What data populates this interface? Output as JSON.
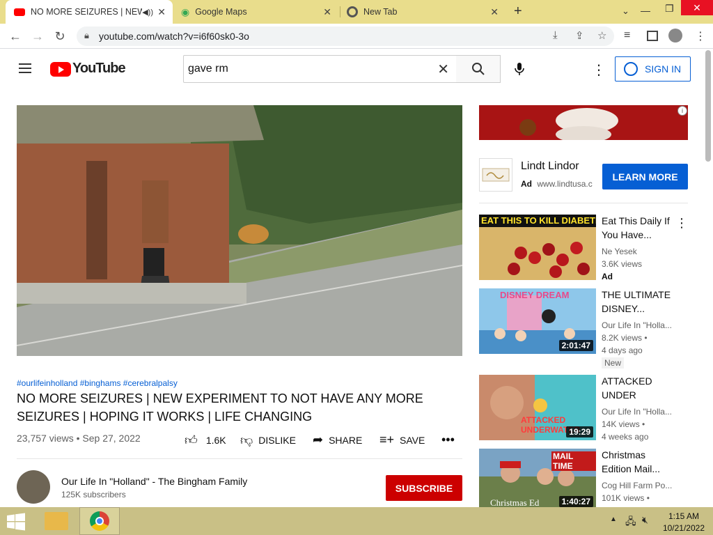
{
  "browser": {
    "tabs": [
      {
        "title": "NO MORE SEIZURES | NEW E",
        "active": true
      },
      {
        "title": "Google Maps",
        "active": false
      },
      {
        "title": "New Tab",
        "active": false
      }
    ],
    "url": "youtube.com/watch?v=i6f60sk0-3o"
  },
  "youtube": {
    "logo_text": "YouTube",
    "search_value": "gave rm",
    "signin_label": "SIGN IN"
  },
  "video": {
    "hashtags": "#ourlifeinholland #binghams #cerebralpalsy",
    "title": "NO MORE SEIZURES | NEW EXPERIMENT TO NOT HAVE ANY MORE SEIZURES | HOPING IT WORKS | LIFE CHANGING",
    "meta": "23,757 views • Sep 27, 2022",
    "likes": "1.6K",
    "dislike_label": "DISLIKE",
    "share_label": "SHARE",
    "save_label": "SAVE",
    "channel_name": "Our Life In \"Holland\" - The Bingham Family",
    "subscribers": "125K subscribers",
    "subscribe_label": "SUBSCRIBE"
  },
  "ad": {
    "advertiser": "Lindt Lindor",
    "ad_label": "Ad",
    "domain": "www.lindtusa.c",
    "learn_more": "LEARN MORE"
  },
  "recommendations": [
    {
      "title": "Eat This Daily If You Have...",
      "channel": "Ne Yesek",
      "views": "3.6K views",
      "extra": "Ad",
      "thumb_text": "EAT THIS TO KILL DIABETES",
      "duration": ""
    },
    {
      "title": "THE ULTIMATE DISNEY...",
      "channel": "Our Life In \"Holla...",
      "views": "8.2K views •",
      "extra": "4 days ago",
      "badge": "New",
      "thumb_text": "DISNEY DREAM",
      "duration": "2:01:47"
    },
    {
      "title": "ATTACKED UNDER WATE...",
      "channel": "Our Life In \"Holla...",
      "views": "14K views •",
      "extra": "4 weeks ago",
      "thumb_text": "ATTACKED UNDERWATER",
      "duration": "19:29"
    },
    {
      "title": "Christmas Edition Mail...",
      "channel": "Cog Hill Farm Po...",
      "views": "101K views •",
      "extra": "",
      "thumb_text": "MAIL TIME",
      "thumb_text2": "Christmas Ed",
      "duration": "1:40:27"
    }
  ],
  "taskbar": {
    "time": "1:15 AM",
    "date": "10/21/2022"
  }
}
